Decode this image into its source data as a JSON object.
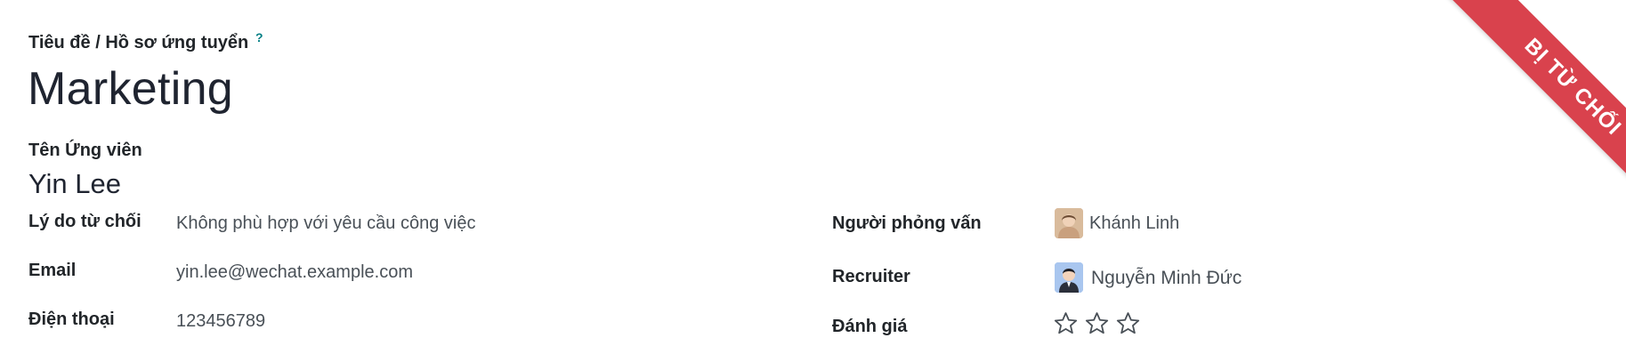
{
  "breadcrumb": "Tiêu đề / Hồ sơ ứng tuyển",
  "help_mark": "?",
  "title": "Marketing",
  "candidate": {
    "label": "Tên Ứng viên",
    "name": "Yin Lee"
  },
  "left_fields": [
    {
      "label": "Lý do từ chối",
      "value": "Không phù hợp với yêu cầu công việc"
    },
    {
      "label": "Email",
      "value": "yin.lee@wechat.example.com"
    },
    {
      "label": "Điện thoại",
      "value": "123456789"
    }
  ],
  "right_fields": {
    "interviewer": {
      "label": "Người phỏng vấn",
      "value": "Khánh Linh"
    },
    "recruiter": {
      "label": "Recruiter",
      "value": "Nguyễn Minh Đức"
    },
    "rating": {
      "label": "Đánh giá",
      "stars_total": 3,
      "stars_filled": 0
    }
  },
  "ribbon": {
    "text": "BỊ TỪ CHỐI",
    "color": "#d9424d"
  }
}
